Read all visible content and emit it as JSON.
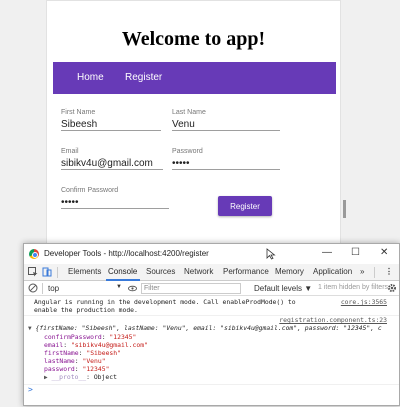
{
  "app": {
    "title": "Welcome to app!",
    "nav": {
      "home": "Home",
      "register": "Register"
    },
    "form": {
      "first_name_label": "First Name",
      "first_name_value": "Sibeesh",
      "last_name_label": "Last Name",
      "last_name_value": "Venu",
      "email_label": "Email",
      "email_value": "sibikv4u@gmail.com",
      "password_label": "Password",
      "password_value": "•••••",
      "confirm_label": "Confirm Password",
      "confirm_value": "•••••",
      "submit_label": "Register"
    }
  },
  "devtools": {
    "title": "Developer Tools - http://localhost:4200/register",
    "window_buttons": {
      "minimize": "—",
      "maximize": "☐",
      "close": "✕"
    },
    "tabs": [
      "Elements",
      "Console",
      "Sources",
      "Network",
      "Performance",
      "Memory",
      "Application"
    ],
    "active_tab": "Console",
    "more_tabs": "»",
    "menu": "⋮",
    "context": "top",
    "filter_placeholder": "Filter",
    "levels": "Default levels ▼",
    "hidden_info": "1 item hidden by filters",
    "console": {
      "log1_line1": "Angular is running in the development mode. Call enableProdMode() to",
      "log1_line2": "enable the production mode.",
      "log1_source": "core.js:3565",
      "log2_source": "registration.component.ts:23",
      "object_summary": "{firstName: \"Sibeesh\", lastName: \"Venu\", email: \"sibikv4u@gmail.com\", password: \"12345\", c",
      "props": [
        {
          "key": "confirmPassword",
          "value": "\"12345\""
        },
        {
          "key": "email",
          "value": "\"sibikv4u@gmail.com\""
        },
        {
          "key": "firstName",
          "value": "\"Sibeesh\""
        },
        {
          "key": "lastName",
          "value": "\"Venu\""
        },
        {
          "key": "password",
          "value": "\"12345\""
        }
      ],
      "proto_key": "__proto__",
      "proto_value": "Object",
      "prompt": ">"
    }
  },
  "colors": {
    "primary": "#673ab7",
    "devtools_accent": "#3879d9"
  }
}
